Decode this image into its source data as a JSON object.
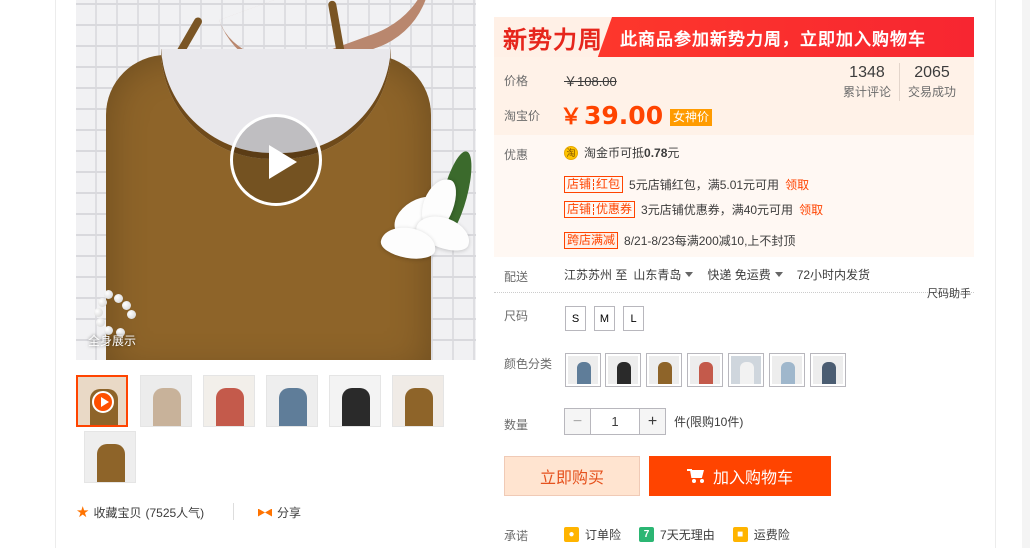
{
  "gallery": {
    "caption": "全身展示",
    "thumbnails": [
      {
        "bg": "#e9d9c6",
        "garment": "#8e6429"
      },
      {
        "bg": "#ececec",
        "garment": "#c8b29a"
      },
      {
        "bg": "#f2efea",
        "garment": "#c45a4b"
      },
      {
        "bg": "#eeeeee",
        "garment": "#5f7d99"
      },
      {
        "bg": "#f3f3f3",
        "garment": "#2a2a2a"
      },
      {
        "bg": "#f0ebe6",
        "garment": "#8e6429"
      },
      {
        "bg": "#eeeeee",
        "garment": "#8e6429"
      }
    ]
  },
  "actions": {
    "collect_label": "收藏宝贝",
    "popularity": "(7525人气)",
    "share_label": "分享"
  },
  "banner": {
    "logo_text": "新势力周",
    "text": "此商品参加新势力周，立即加入购物车"
  },
  "price": {
    "label": "价格",
    "original": "￥108.00",
    "taobao_label": "淘宝价",
    "currency": "￥",
    "current": "39.00",
    "badge": "女神价"
  },
  "stats": [
    {
      "value": "1348",
      "label": "累计评论"
    },
    {
      "value": "2065",
      "label": "交易成功"
    }
  ],
  "promotions": {
    "label": "优惠",
    "taojin_icon": "淘",
    "taojin_prefix": "淘金币可抵",
    "taojin_amount": "0.78",
    "taojin_suffix": "元",
    "red_packet": {
      "tag_a": "店铺",
      "tag_b": "红包",
      "text": "5元店铺红包，满5.01元可用",
      "link": "领取"
    },
    "coupon": {
      "tag_a": "店铺",
      "tag_b": "优惠券",
      "text": "3元店铺优惠券，满40元可用",
      "link": "领取"
    },
    "cross_store": {
      "tag": "跨店满减",
      "text": "8/21-8/23每满200减10,上不封顶"
    }
  },
  "shipping": {
    "label": "配送",
    "from": "江苏苏州 至",
    "to": "山东青岛",
    "method": "快递 免运费",
    "delivery": "72小时内发货"
  },
  "size": {
    "label": "尺码",
    "helper": "尺码助手",
    "options": [
      "S",
      "M",
      "L"
    ]
  },
  "color": {
    "label": "颜色分类",
    "swatches": [
      "#5f7d99",
      "#2a2a2a",
      "#8e6429",
      "#c45a4b",
      "#f2f2f2",
      "#9fb7cc",
      "#4b5d72"
    ]
  },
  "quantity": {
    "label": "数量",
    "minus": "−",
    "plus": "+",
    "value": "1",
    "note": "件(限购10件)"
  },
  "buttons": {
    "buy_now": "立即购买",
    "add_to_cart": "加入购物车"
  },
  "promise": {
    "label": "承诺",
    "items": [
      {
        "text": "订单险",
        "icon_color": "#ffb400"
      },
      {
        "text": "7天无理由",
        "icon_text": "7",
        "icon_color": "#2bb673"
      },
      {
        "text": "运费险",
        "icon_color": "#ffb400"
      }
    ]
  }
}
